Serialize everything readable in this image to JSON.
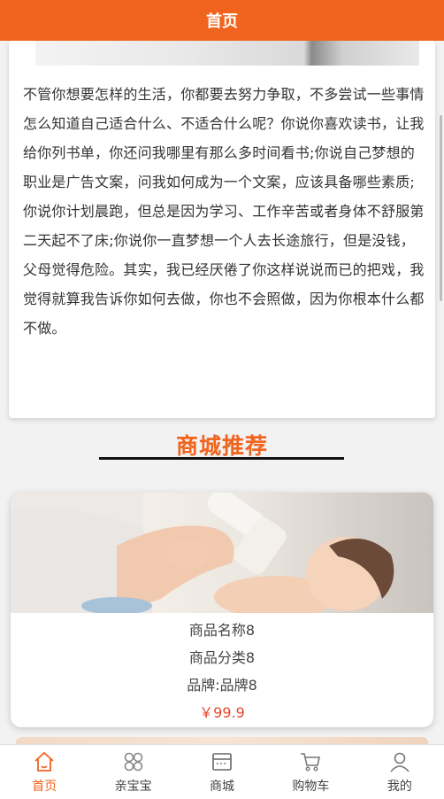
{
  "header": {
    "title": "首页"
  },
  "article": {
    "text": "不管你想要怎样的生活，你都要去努力争取，不多尝试一些事情怎么知道自己适合什么、不适合什么呢？你说你喜欢读书，让我给你列书单，你还问我哪里有那么多时间看书;你说自己梦想的职业是广告文案，问我如何成为一个文案，应该具备哪些素质;你说你计划晨跑，但总是因为学习、工作辛苦或者身体不舒服第二天起不了床;你说你一直梦想一个人去长途旅行，但是没钱，父母觉得危险。其实，我已经厌倦了你这样说说而已的把戏，我觉得就算我告诉你如何去做，你也不会照做，因为你根本什么都不做。"
  },
  "section": {
    "title": "商城推荐"
  },
  "product": {
    "name": "商品名称8",
    "category": "商品分类8",
    "brand": "品牌:品牌8",
    "price": "￥99.9"
  },
  "tabs": [
    {
      "label": "首页",
      "icon": "home-icon",
      "active": true
    },
    {
      "label": "亲宝宝",
      "icon": "grid-icon",
      "active": false
    },
    {
      "label": "商城",
      "icon": "shop-icon",
      "active": false
    },
    {
      "label": "购物车",
      "icon": "cart-icon",
      "active": false
    },
    {
      "label": "我的",
      "icon": "user-icon",
      "active": false
    }
  ],
  "colors": {
    "accent": "#f0641e",
    "price": "#e8452c"
  }
}
